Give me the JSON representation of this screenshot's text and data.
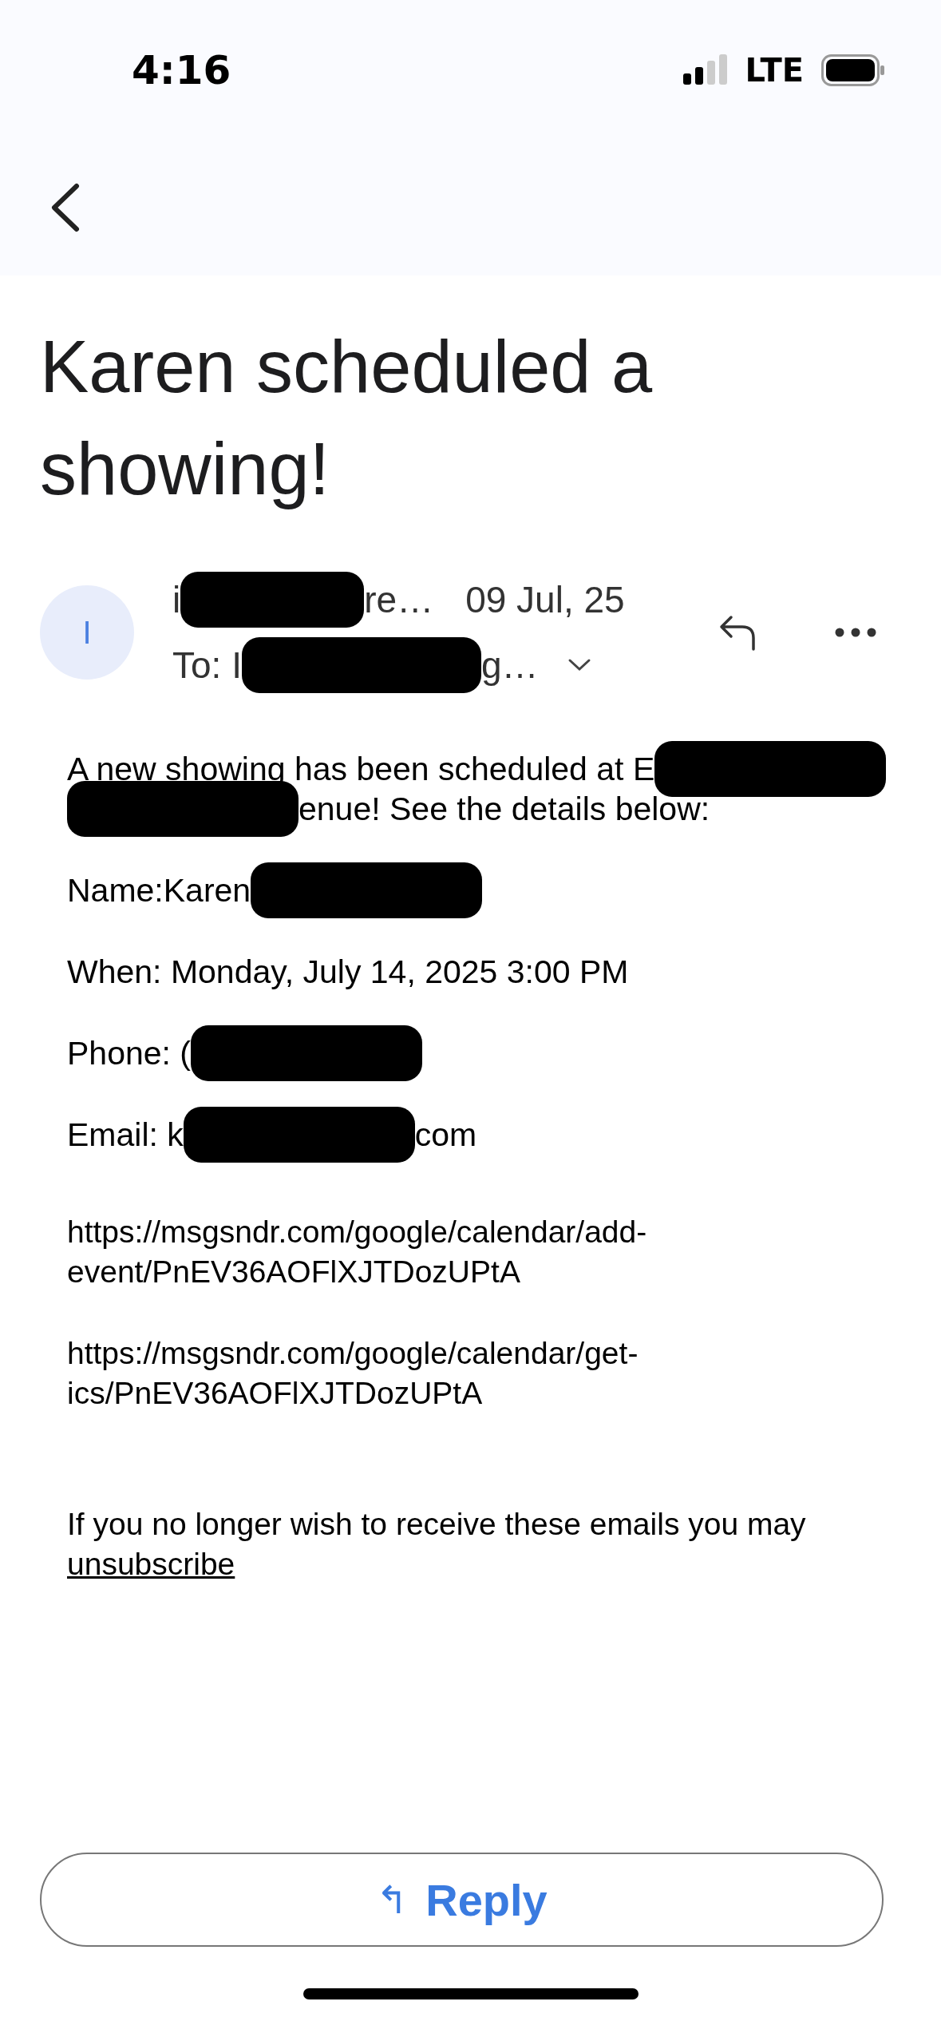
{
  "status_bar": {
    "time": "4:16",
    "network": "LTE"
  },
  "subject": "Karen scheduled a showing!",
  "sender": {
    "avatar_initial": "I",
    "name_start": "i",
    "name_end": "re…",
    "date": "09 Jul, 25",
    "to_start": "To: I",
    "to_end": "g…"
  },
  "body": [
    {
      "lines": [
        [
          {
            "kind": "text",
            "text": "A new showing has been scheduled at E"
          },
          {
            "kind": "redacted"
          }
        ],
        [
          {
            "kind": "redacted"
          },
          {
            "kind": "text",
            "text": "enue! See the details below:"
          }
        ]
      ]
    },
    {
      "lines": [
        [
          {
            "kind": "text",
            "text": "Name:Karen"
          },
          {
            "kind": "redacted"
          }
        ]
      ]
    },
    {
      "lines": [
        [
          {
            "kind": "text",
            "text": "When: Monday, July 14, 2025 3:00 PM"
          }
        ]
      ]
    },
    {
      "lines": [
        [
          {
            "kind": "text",
            "text": "Phone: ("
          },
          {
            "kind": "redacted"
          }
        ]
      ]
    },
    {
      "lines": [
        [
          {
            "kind": "text",
            "text": "Email: k"
          },
          {
            "kind": "redacted"
          },
          {
            "kind": "text",
            "text": "com"
          }
        ]
      ]
    }
  ],
  "links": [
    "https://msgsndr.com/google/calendar/add-event/PnEV36AOFlXJTDozUPtA",
    "https://msgsndr.com/google/calendar/get-ics/PnEV36AOFlXJTDozUPtA"
  ],
  "footer": {
    "text": "If you no longer wish to receive these emails you may",
    "link": "unsubscribe"
  },
  "reply_button": {
    "icon": "↰",
    "label": "Reply"
  }
}
